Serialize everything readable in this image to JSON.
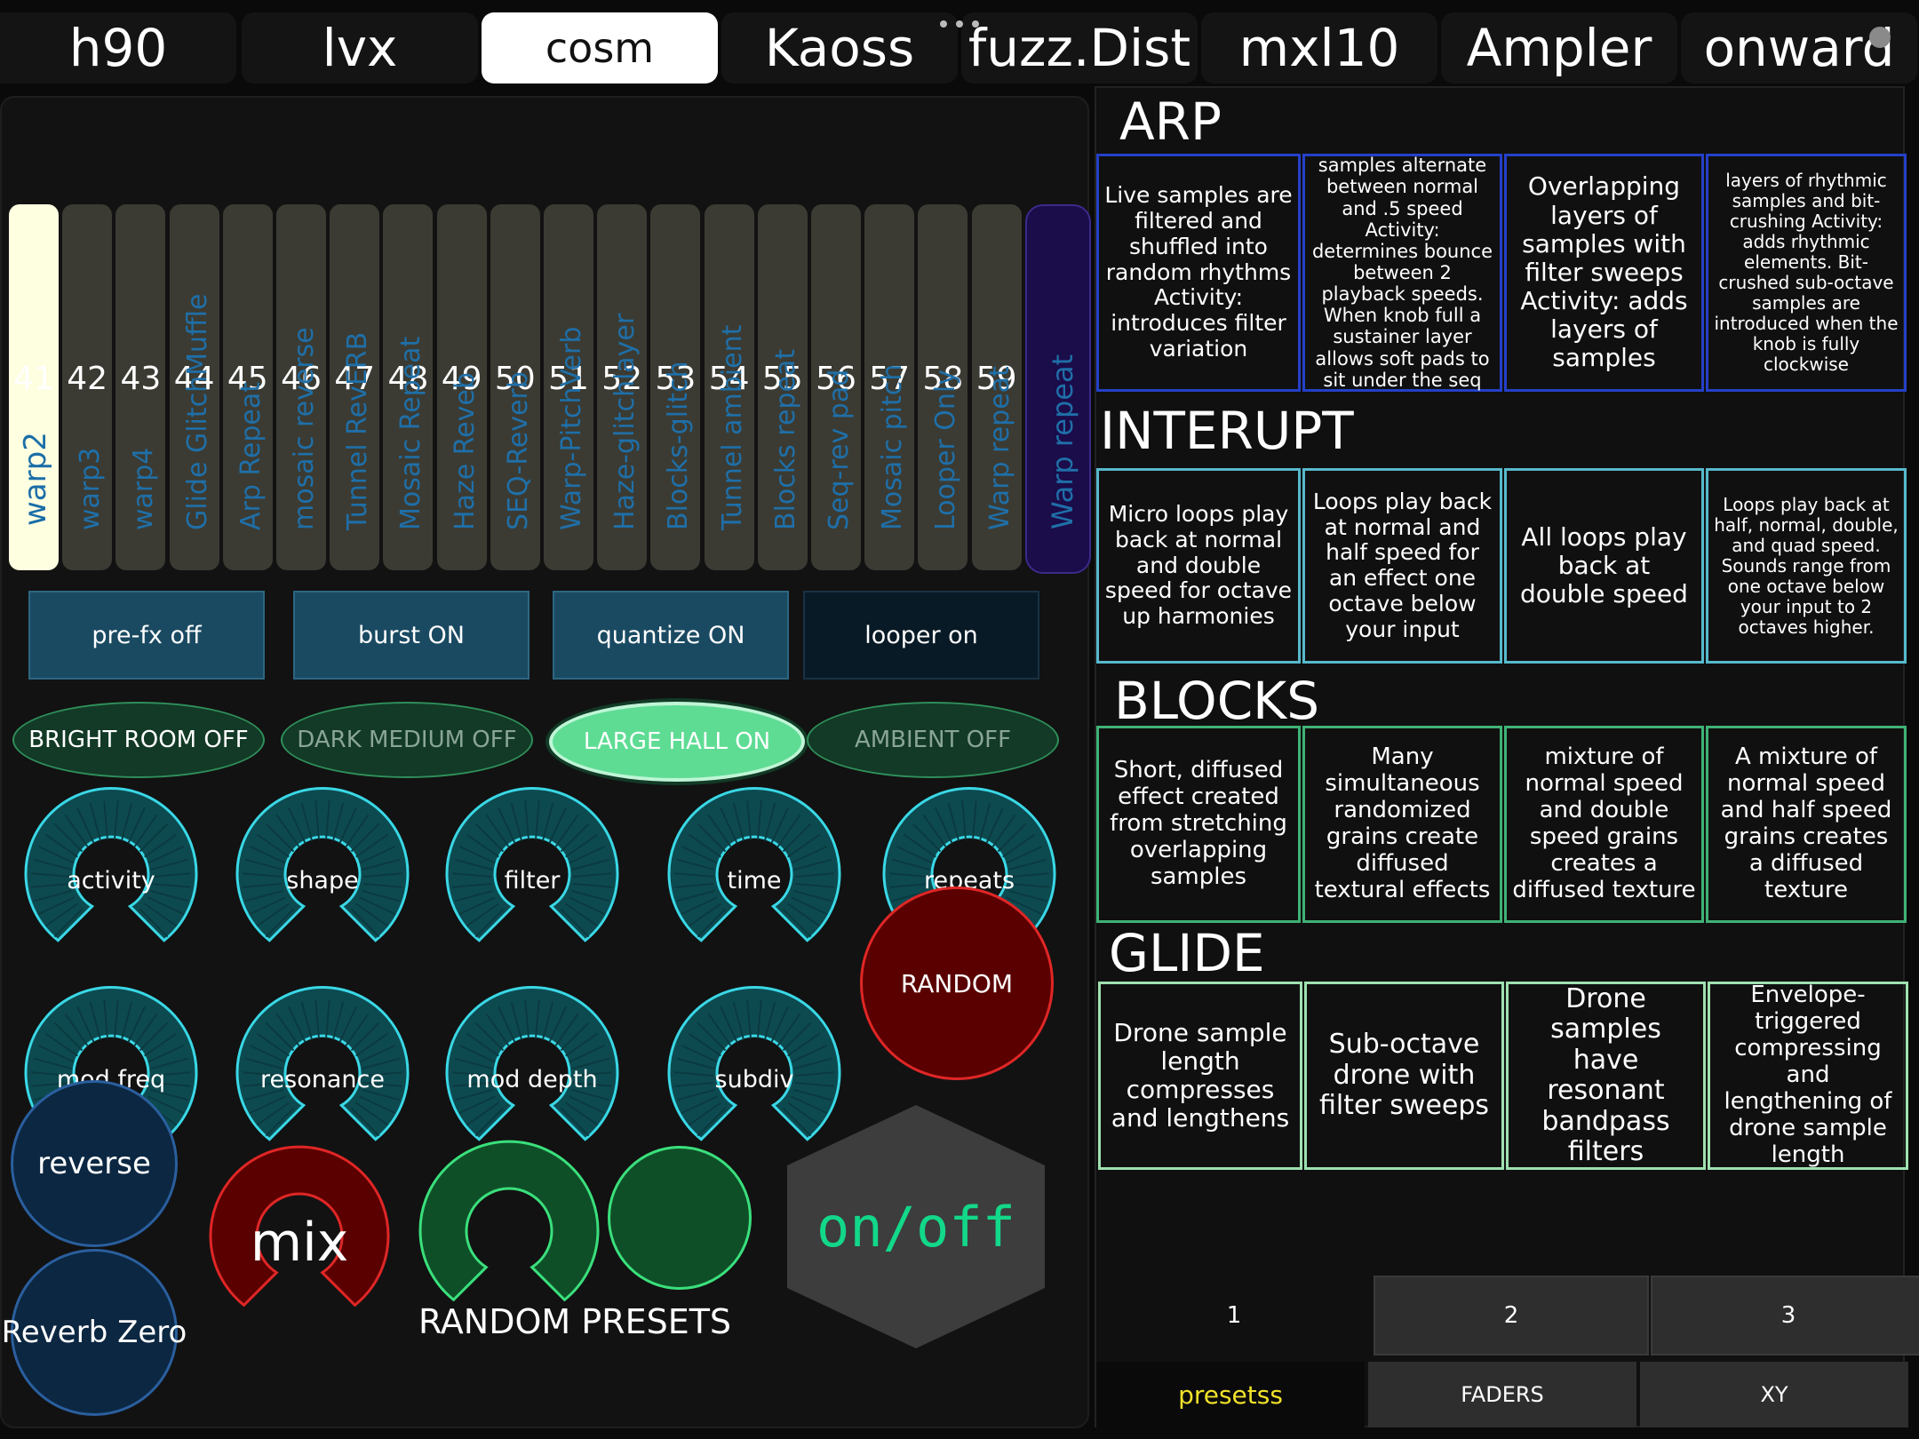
{
  "tabs": [
    {
      "label": "h90"
    },
    {
      "label": "lvx"
    },
    {
      "label": "cosm",
      "active": true
    },
    {
      "label": "Kaoss"
    },
    {
      "label": "fuzz.Dist"
    },
    {
      "label": "mxl10"
    },
    {
      "label": "Ampler"
    },
    {
      "label": "onward"
    }
  ],
  "faders": [
    {
      "num": "41",
      "label": "warp2"
    },
    {
      "num": "42",
      "label": "warp3"
    },
    {
      "num": "43",
      "label": "warp4"
    },
    {
      "num": "44",
      "label": "Glide GlitchMuffle"
    },
    {
      "num": "45",
      "label": "Arp Repeat"
    },
    {
      "num": "46",
      "label": "mosaic reverse"
    },
    {
      "num": "47",
      "label": "Tunnel RevERB"
    },
    {
      "num": "48",
      "label": "Mosaic Repeat"
    },
    {
      "num": "49",
      "label": "Haze Reveb"
    },
    {
      "num": "50",
      "label": "SEQ-Reverb"
    },
    {
      "num": "51",
      "label": "Warp-PitchVerb"
    },
    {
      "num": "52",
      "label": "Haze-glitchlayer"
    },
    {
      "num": "53",
      "label": "Blocks-glitch"
    },
    {
      "num": "54",
      "label": "Tunnel ambient"
    },
    {
      "num": "55",
      "label": "Blocks repeat"
    },
    {
      "num": "56",
      "label": "Seq-rev pad"
    },
    {
      "num": "57",
      "label": "Mosaic pitch"
    },
    {
      "num": "58",
      "label": "Looper Only"
    },
    {
      "num": "59",
      "label": "Warp repeat"
    },
    {
      "num": "",
      "label": "Warp repeat"
    }
  ],
  "toggles": {
    "prefx": "pre-fx off",
    "burst": "burst ON",
    "quantize": "quantize ON",
    "looper": "looper on"
  },
  "reverbs": {
    "bright": "BRIGHT ROOM OFF",
    "dark": "DARK MEDIUM OFF",
    "large": "LARGE HALL ON",
    "ambient": "AMBIENT OFF"
  },
  "knobs": {
    "activity": "activity",
    "shape": "shape",
    "filter": "filter",
    "time": "time",
    "repeats": "repeats",
    "modfreq": "mod freq",
    "resonance": "resonance",
    "moddepth": "mod depth",
    "subdiv": "subdiv"
  },
  "buttons": {
    "random": "RANDOM",
    "reverse": "reverse",
    "reverb_zero": "Reverb Zero",
    "mix": "mix",
    "random_presets": "RANDOM PRESETS",
    "onoff": "on/off"
  },
  "sections": {
    "arp": {
      "title": "ARP",
      "cells": [
        "Live samples are filtered and shuffled into random rhythms Activity: introduces filter variation",
        "samples alternate between normal and .5 speed Activity: determines bounce between 2 playback speeds. When knob full a sustainer layer allows soft pads to sit under the seq",
        "Overlapping layers of samples with filter sweeps Activity: adds layers of samples",
        "layers of rhythmic samples and bit-crushing Activity: adds rhythmic elements. Bit-crushed sub-octave samples are introduced when the knob is fully clockwise"
      ]
    },
    "interupt": {
      "title": "INTERUPT",
      "cells": [
        "Micro loops play back at normal and double speed for octave up harmonies",
        "Loops play back at normal and half speed for an effect one octave below your input",
        "All loops play back at double speed",
        "Loops play back at half, normal, double, and quad speed. Sounds range from one octave below your input to 2 octaves higher."
      ]
    },
    "blocks": {
      "title": "BLOCKS",
      "cells": [
        "Short, diffused effect created from stretching overlapping samples",
        "Many simultaneous randomized grains create diffused textural effects",
        "mixture of normal speed and double speed grains creates a diffused texture",
        "A mixture of normal speed and half speed grains creates a diffused texture"
      ]
    },
    "glide": {
      "title": "GLIDE",
      "cells": [
        "Drone sample length compresses and lengthens",
        "Sub-octave drone with filter sweeps",
        "Drone samples have resonant bandpass filters",
        "Envelope-triggered compressing and lengthening of drone sample length"
      ]
    }
  },
  "page_tabs": [
    "1",
    "2",
    "3"
  ],
  "bottom_tabs": [
    "presetss",
    "FADERS",
    "XY"
  ],
  "colors": {
    "teal_knob": "#0d4a50",
    "teal_stroke": "#3ad8e6",
    "red_knob": "#5a0000",
    "red_stroke": "#e02626",
    "green_knob": "#0f4f28",
    "green_stroke": "#3ae07c",
    "active_tab_text": "#f0e22a"
  }
}
